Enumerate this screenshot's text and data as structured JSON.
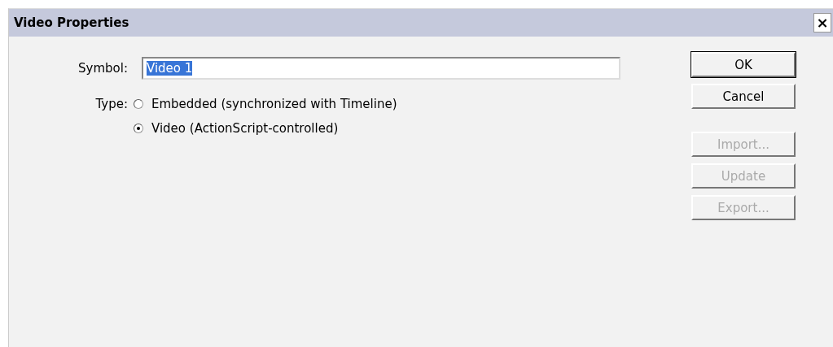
{
  "window": {
    "title": "Video Properties",
    "close": "×"
  },
  "symbol": {
    "label": "Symbol:",
    "value": "Video 1"
  },
  "type": {
    "label": "Type:",
    "options": [
      {
        "label": "Embedded (synchronized with Timeline)",
        "selected": false
      },
      {
        "label": "Video (ActionScript-controlled)",
        "selected": true
      }
    ]
  },
  "buttons": [
    {
      "label": "OK",
      "default": true,
      "disabled": false
    },
    {
      "label": "Cancel",
      "default": false,
      "disabled": false
    }
  ],
  "file_buttons": [
    {
      "label": "Import...",
      "default": false,
      "disabled": true
    },
    {
      "label": "Update",
      "default": false,
      "disabled": true
    },
    {
      "label": "Export...",
      "default": false,
      "disabled": true
    }
  ]
}
